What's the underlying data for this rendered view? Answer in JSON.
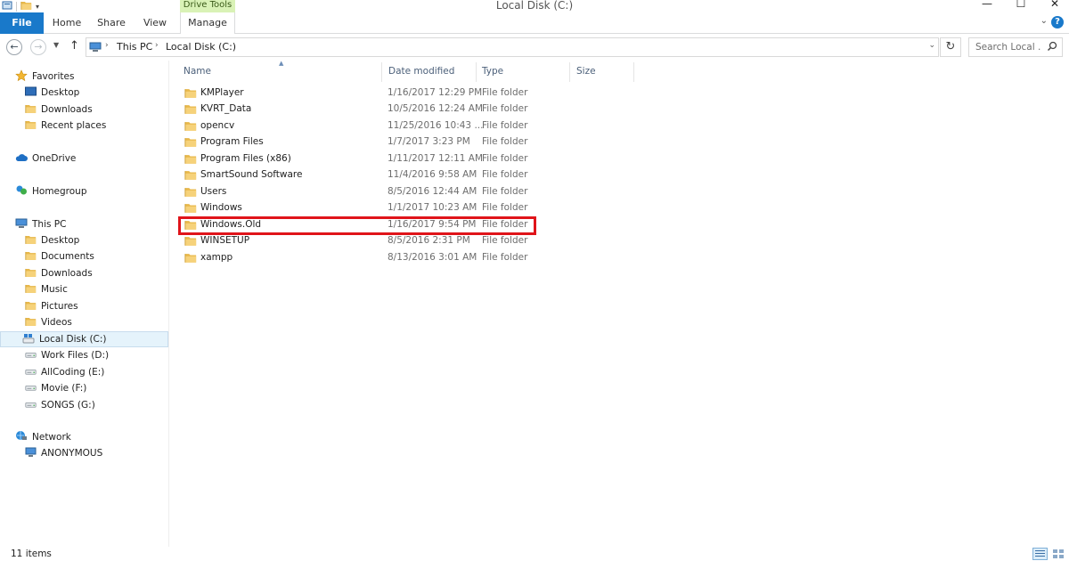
{
  "window": {
    "title": "Local Disk (C:)",
    "context_tab_group": "Drive Tools",
    "controls": {
      "minimize": "—",
      "maximize": "☐",
      "close": "✕"
    }
  },
  "ribbon": {
    "tabs": [
      {
        "label": "File",
        "active": true
      },
      {
        "label": "Home"
      },
      {
        "label": "Share"
      },
      {
        "label": "View"
      },
      {
        "label": "Manage"
      }
    ]
  },
  "address": {
    "breadcrumbs": [
      "This PC",
      "Local Disk (C:)"
    ],
    "search_placeholder": "Search Local ..."
  },
  "nav_pane": {
    "items": [
      {
        "label": "Favorites",
        "icon": "star-icon"
      },
      {
        "label": "Desktop",
        "icon": "desktop-icon"
      },
      {
        "label": "Downloads",
        "icon": "downloads-folder-icon"
      },
      {
        "label": "Recent places",
        "icon": "recent-places-icon"
      },
      {
        "label": "OneDrive",
        "icon": "onedrive-icon"
      },
      {
        "label": "Homegroup",
        "icon": "homegroup-icon"
      },
      {
        "label": "This PC",
        "icon": "computer-icon"
      },
      {
        "label": "Desktop",
        "icon": "folder-icon"
      },
      {
        "label": "Documents",
        "icon": "folder-icon"
      },
      {
        "label": "Downloads",
        "icon": "folder-icon"
      },
      {
        "label": "Music",
        "icon": "music-folder-icon"
      },
      {
        "label": "Pictures",
        "icon": "pictures-folder-icon"
      },
      {
        "label": "Videos",
        "icon": "videos-folder-icon"
      },
      {
        "label": "Local Disk (C:)",
        "icon": "system-drive-icon",
        "selected": true
      },
      {
        "label": "Work Files (D:)",
        "icon": "drive-icon"
      },
      {
        "label": "AllCoding (E:)",
        "icon": "drive-icon"
      },
      {
        "label": "Movie (F:)",
        "icon": "drive-icon"
      },
      {
        "label": "SONGS (G:)",
        "icon": "drive-icon"
      },
      {
        "label": "Network",
        "icon": "network-icon"
      },
      {
        "label": "ANONYMOUS",
        "icon": "network-computer-icon"
      }
    ]
  },
  "file_list": {
    "columns": [
      "Name",
      "Date modified",
      "Type",
      "Size"
    ],
    "sort_column": "Name",
    "rows": [
      {
        "name": "KMPlayer",
        "date": "1/16/2017 12:29 PM",
        "type": "File folder"
      },
      {
        "name": "KVRT_Data",
        "date": "10/5/2016 12:24 AM",
        "type": "File folder"
      },
      {
        "name": "opencv",
        "date": "11/25/2016 10:43 ...",
        "type": "File folder"
      },
      {
        "name": "Program Files",
        "date": "1/7/2017 3:23 PM",
        "type": "File folder"
      },
      {
        "name": "Program Files (x86)",
        "date": "1/11/2017 12:11 AM",
        "type": "File folder"
      },
      {
        "name": "SmartSound Software",
        "date": "11/4/2016 9:58 AM",
        "type": "File folder"
      },
      {
        "name": "Users",
        "date": "8/5/2016 12:44 AM",
        "type": "File folder"
      },
      {
        "name": "Windows",
        "date": "1/1/2017 10:23 AM",
        "type": "File folder"
      },
      {
        "name": "Windows.Old",
        "date": "1/16/2017 9:54 PM",
        "type": "File folder",
        "highlighted": true
      },
      {
        "name": "WINSETUP",
        "date": "8/5/2016 2:31 PM",
        "type": "File folder"
      },
      {
        "name": "xampp",
        "date": "8/13/2016 3:01 AM",
        "type": "File folder"
      }
    ]
  },
  "status_bar": {
    "item_count": "11 items"
  },
  "colors": {
    "file_tab": "#1979ca",
    "drive_tools": "#d9f2b6",
    "highlight": "#e0141a",
    "folder": "#e8b84a"
  }
}
